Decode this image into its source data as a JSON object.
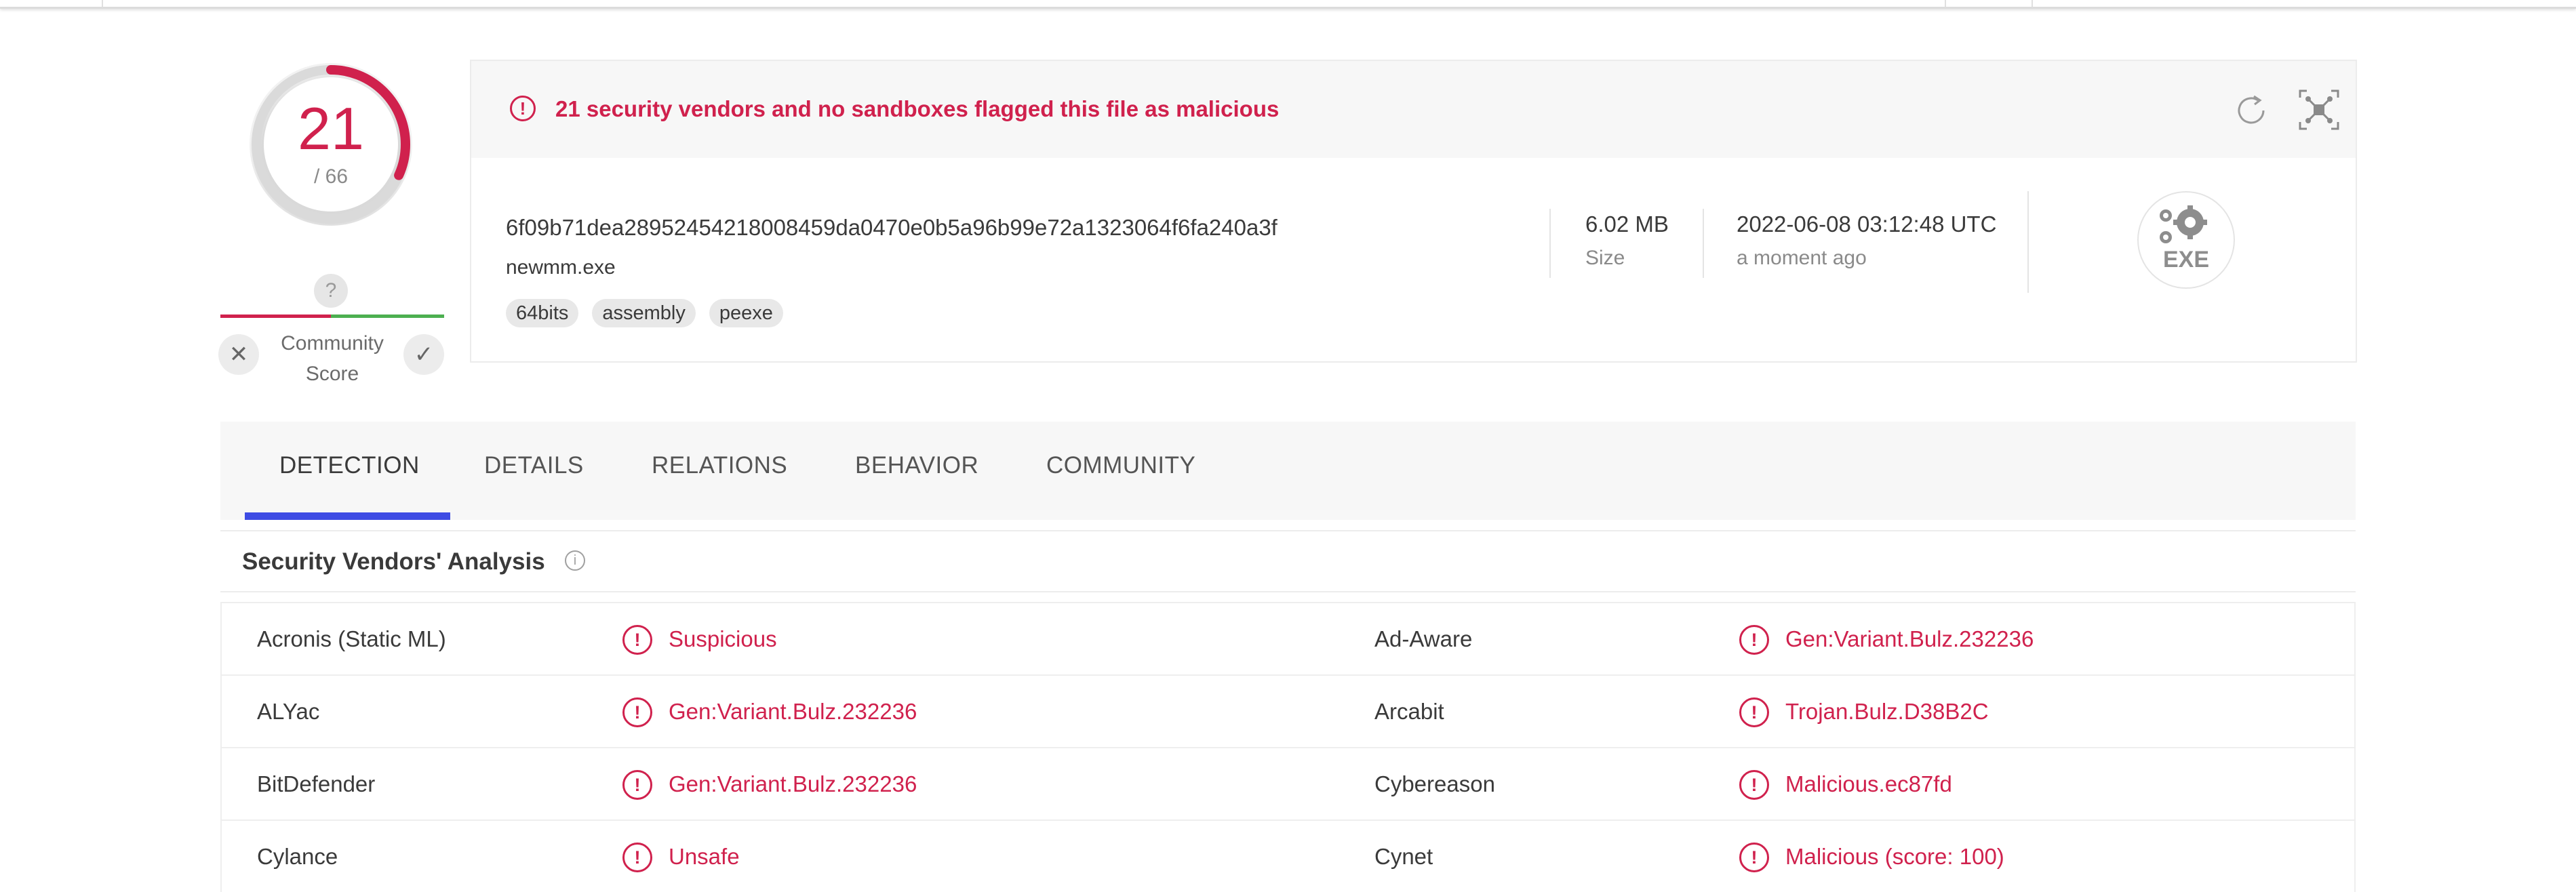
{
  "score": {
    "detected": "21",
    "total": "/ 66",
    "fraction": 0.318
  },
  "community": {
    "unknown_icon": "?",
    "label_line1": "Community",
    "label_line2": "Score",
    "vote_down_icon": "close-icon",
    "vote_up_icon": "check-icon"
  },
  "alert": {
    "text": "21 security vendors and no sandboxes flagged this file as malicious"
  },
  "file": {
    "hash": "6f09b71dea28952454218008459da0470e0b5a96b99e72a1323064f6fa240a3f",
    "name": "newmm.exe",
    "tags": [
      "64bits",
      "assembly",
      "peexe"
    ],
    "size_value": "6.02 MB",
    "size_label": "Size",
    "date_value": "2022-06-08 03:12:48 UTC",
    "date_label": "a moment ago",
    "type_label": "EXE"
  },
  "tabs": [
    "DETECTION",
    "DETAILS",
    "RELATIONS",
    "BEHAVIOR",
    "COMMUNITY"
  ],
  "active_tab": "DETECTION",
  "section": {
    "title": "Security Vendors' Analysis",
    "info_icon": "i"
  },
  "results": [
    {
      "left_vendor": "Acronis (Static ML)",
      "left_result": "Suspicious",
      "right_vendor": "Ad-Aware",
      "right_result": "Gen:Variant.Bulz.232236"
    },
    {
      "left_vendor": "ALYac",
      "left_result": "Gen:Variant.Bulz.232236",
      "right_vendor": "Arcabit",
      "right_result": "Trojan.Bulz.D38B2C"
    },
    {
      "left_vendor": "BitDefender",
      "left_result": "Gen:Variant.Bulz.232236",
      "right_vendor": "Cybereason",
      "right_result": "Malicious.ec87fd"
    },
    {
      "left_vendor": "Cylance",
      "left_result": "Unsafe",
      "right_vendor": "Cynet",
      "right_result": "Malicious (score: 100)"
    }
  ],
  "colors": {
    "malicious": "#d0214d",
    "tab_accent": "#3e4ce4",
    "community_red": "#d0214d",
    "community_green": "#4caf50"
  }
}
